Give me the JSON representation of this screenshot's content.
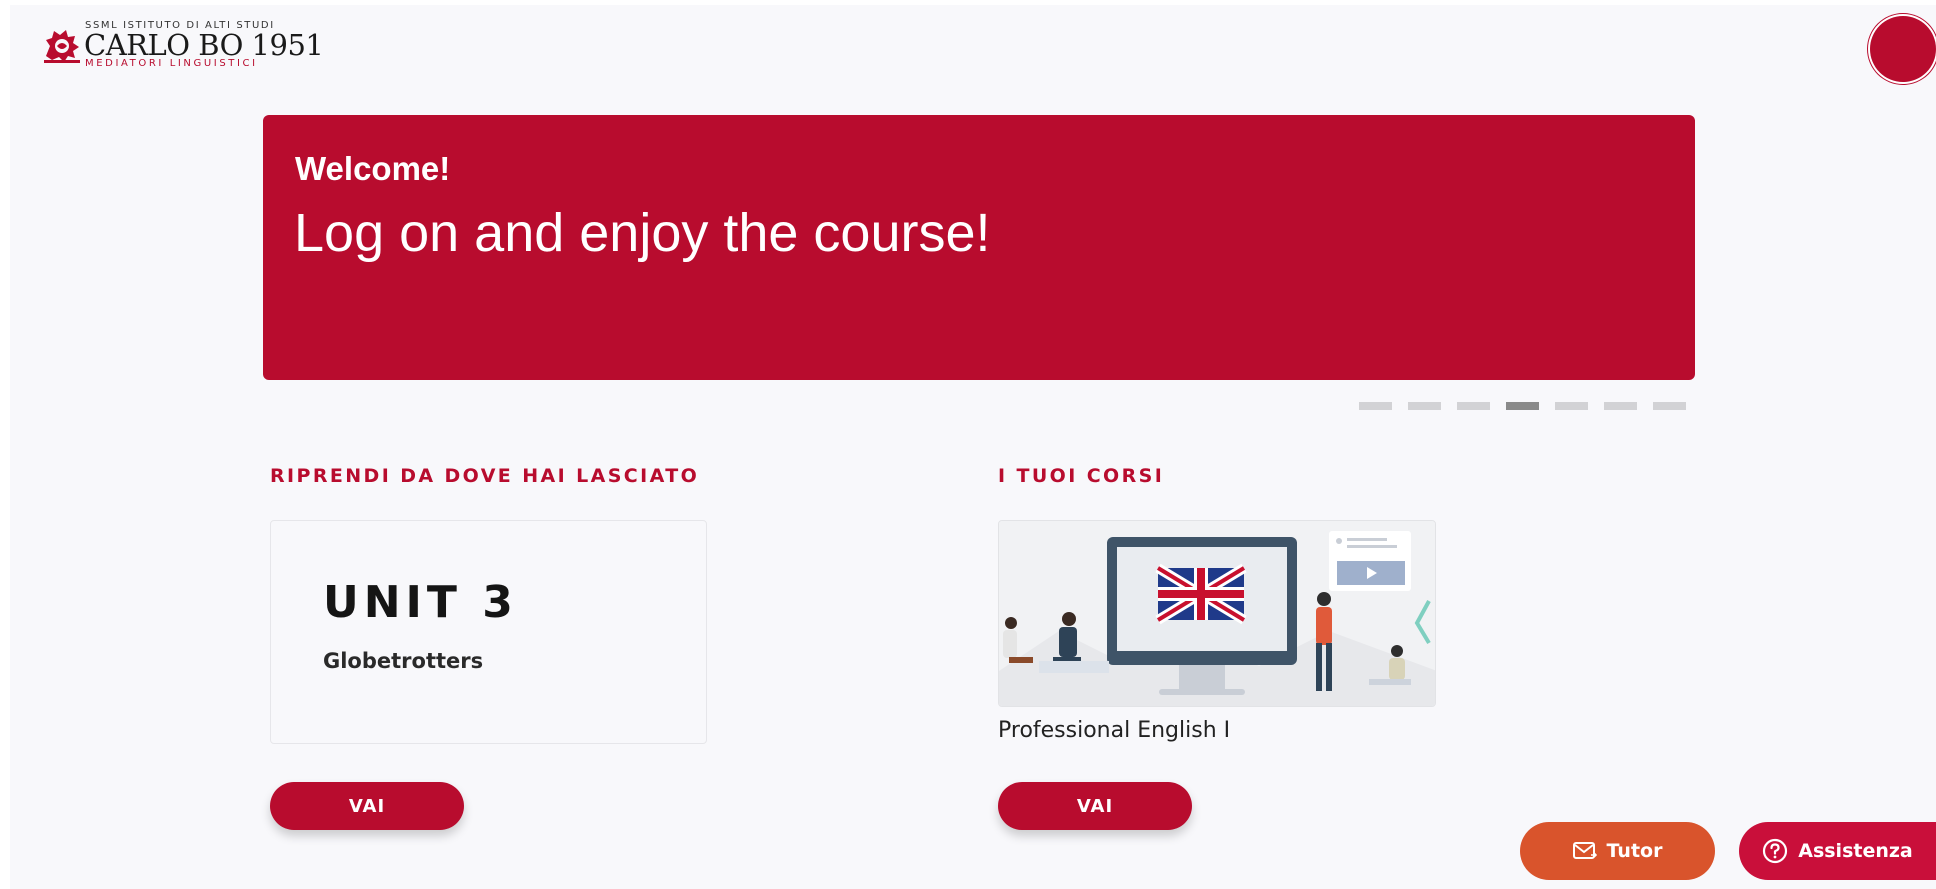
{
  "header": {
    "logo": {
      "top_line": "SSML ISTITUTO DI ALTI STUDI",
      "main": "CARLO BO 1951",
      "sub": "MEDIATORI LINGUISTICI"
    },
    "avatar_icon": "user-avatar"
  },
  "banner": {
    "welcome": "Welcome!",
    "text": "Log on and enjoy the course!",
    "color": "#b80c2e",
    "slides_total": 7,
    "active_slide": 4
  },
  "resume": {
    "title": "RIPRENDI DA DOVE HAI LASCIATO",
    "unit_title": "UNIT 3",
    "unit_subtitle": "Globetrotters",
    "button_label": "VAI"
  },
  "courses": {
    "title": "I TUOI CORSI",
    "items": [
      {
        "name": "Professional English I",
        "image_icon": "uk-flag-monitor-illustration",
        "button_label": "VAI"
      }
    ]
  },
  "floating": {
    "tutor_label": "Tutor",
    "tutor_icon": "mail-icon",
    "tutor_color": "#d9542c",
    "assist_label": "Assistenza",
    "assist_icon": "question-icon",
    "assist_color": "#c90f3a"
  }
}
